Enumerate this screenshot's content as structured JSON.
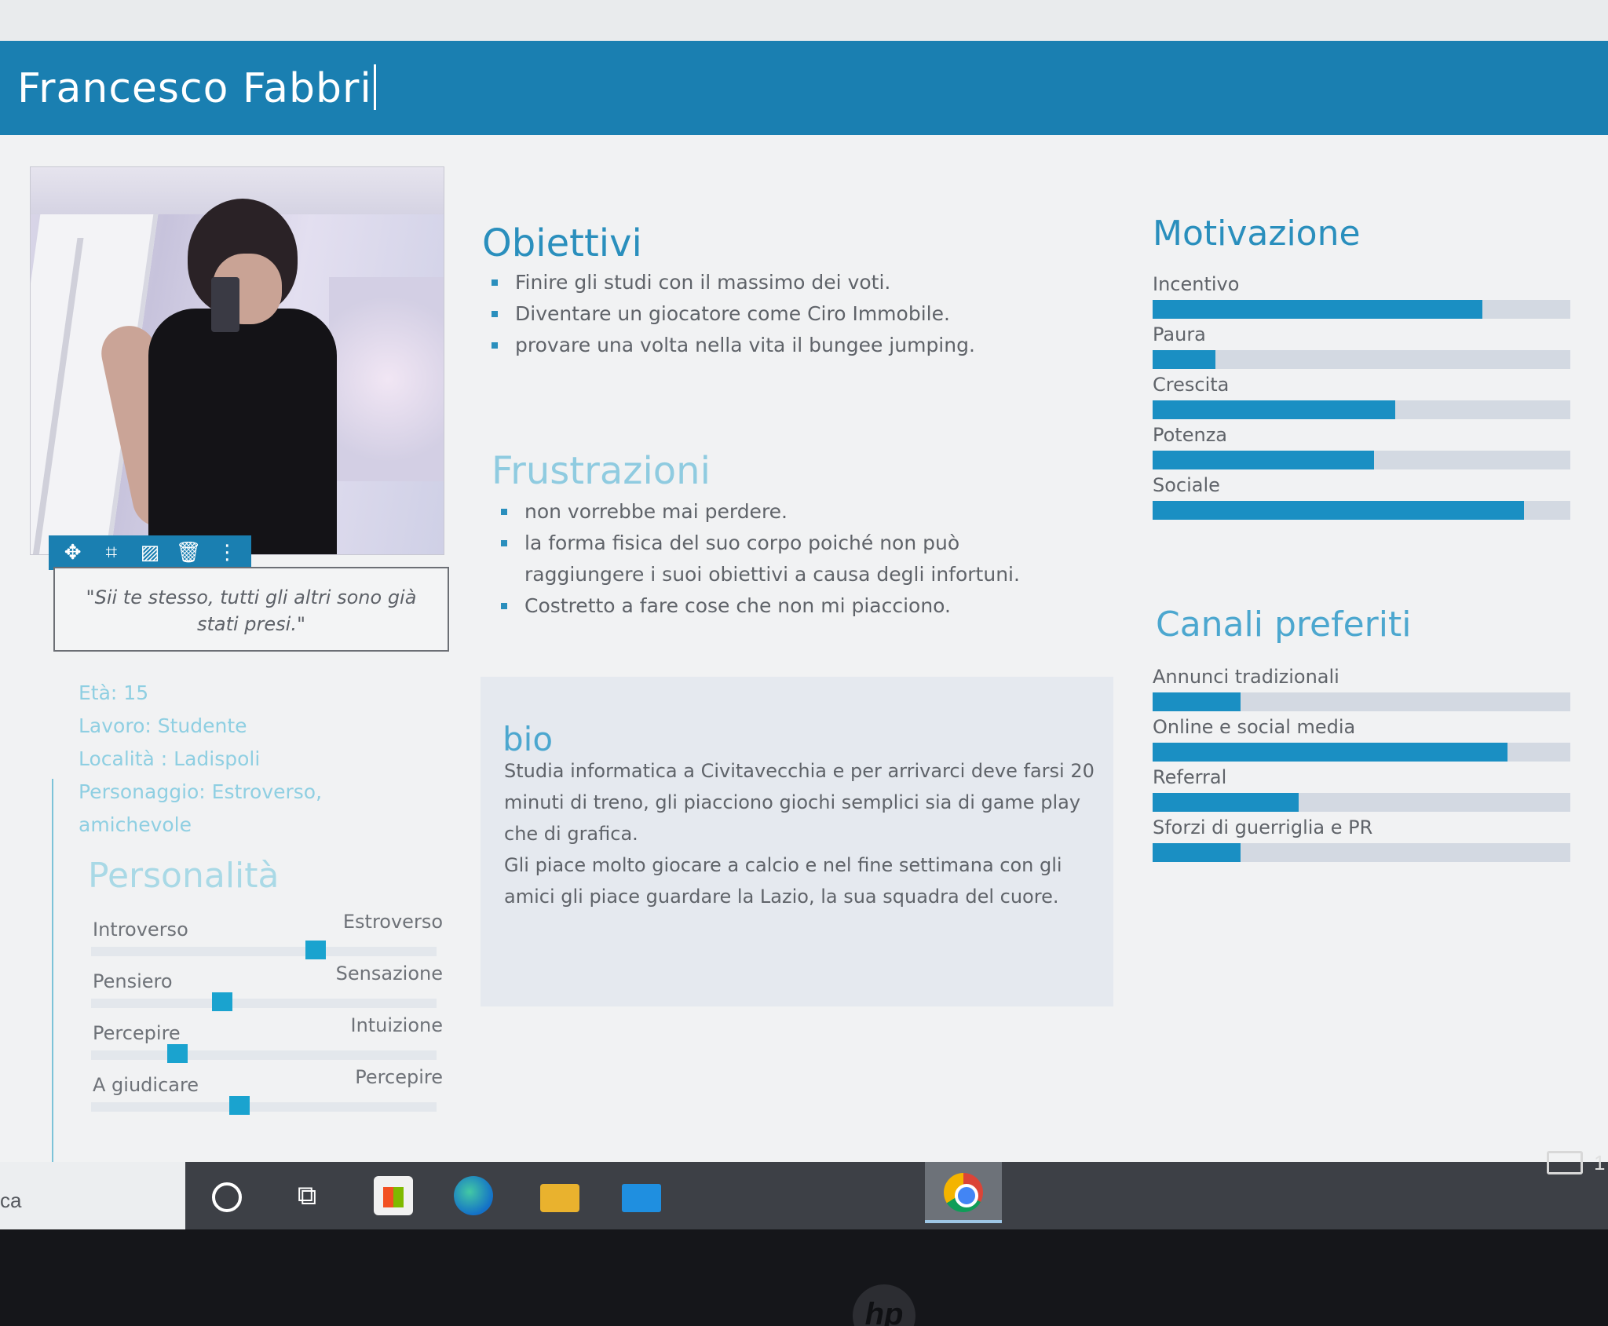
{
  "header": {
    "name_value": "Francesco Fabbri"
  },
  "photo": {
    "toolbar_icons": [
      "move-icon",
      "crop-icon",
      "image-icon",
      "trash-icon",
      "more-icon"
    ],
    "quote": "\"Sii te stesso, tutti gli altri sono già stati presi.\""
  },
  "info": {
    "eta": "Età: 15",
    "lavoro": "Lavoro: Studente",
    "localita": "Località : Ladispoli",
    "personaggio": "Personaggio: Estroverso, amichevole"
  },
  "personalita": {
    "title": "Personalità",
    "rows": [
      {
        "left": "Introverso",
        "right": "Estroverso",
        "value": 0.65
      },
      {
        "left": "Pensiero",
        "right": "Sensazione",
        "value": 0.38
      },
      {
        "left": "Percepire",
        "right": "Intuizione",
        "value": 0.25
      },
      {
        "left": "A giudicare",
        "right": "Percepire",
        "value": 0.43
      }
    ]
  },
  "obiettivi": {
    "title": "Obiettivi",
    "items": [
      "Finire gli studi con il massimo dei voti.",
      "Diventare un giocatore come Ciro Immobile.",
      "provare una volta nella vita il bungee jumping."
    ]
  },
  "frustrazioni": {
    "title": "Frustrazioni",
    "items": [
      "non vorrebbe mai perdere.",
      "la forma fisica del suo corpo poiché non può raggiungere i suoi obiettivi a causa degli infortuni.",
      "Costretto a fare cose che non mi piacciono."
    ]
  },
  "bio": {
    "title": "bio",
    "text1": "Studia informatica a Civitavecchia e per arrivarci deve farsi 20 minuti di treno, gli piacciono giochi semplici sia di game play che di grafica.",
    "text2": "Gli piace molto giocare a calcio e nel fine settimana con gli amici gli piace guardare la Lazio, la sua squadra del cuore."
  },
  "motivazione": {
    "title": "Motivazione",
    "bars": [
      {
        "label": "Incentivo",
        "value": 0.79
      },
      {
        "label": "Paura",
        "value": 0.15
      },
      {
        "label": "Crescita",
        "value": 0.58
      },
      {
        "label": "Potenza",
        "value": 0.53
      },
      {
        "label": "Sociale",
        "value": 0.89
      }
    ]
  },
  "canali": {
    "title": "Canali preferiti",
    "bars": [
      {
        "label": "Annunci tradizionali",
        "value": 0.21
      },
      {
        "label": "Online e social media",
        "value": 0.85
      },
      {
        "label": "Referral",
        "value": 0.35
      },
      {
        "label": "Sforzi di guerriglia e PR",
        "value": 0.21
      }
    ]
  },
  "taskbar": {
    "search_stub": "ca",
    "tray_number": "1",
    "icons": [
      "cortana-icon",
      "task-view-icon",
      "store-icon",
      "edge-icon",
      "file-explorer-icon",
      "mail-icon",
      "chrome-icon"
    ]
  },
  "colors": {
    "accent": "#1a7fb1",
    "bar_fill": "#1a8fc3",
    "bar_track": "#d3d9e2",
    "heading": "#2a8fbd"
  }
}
